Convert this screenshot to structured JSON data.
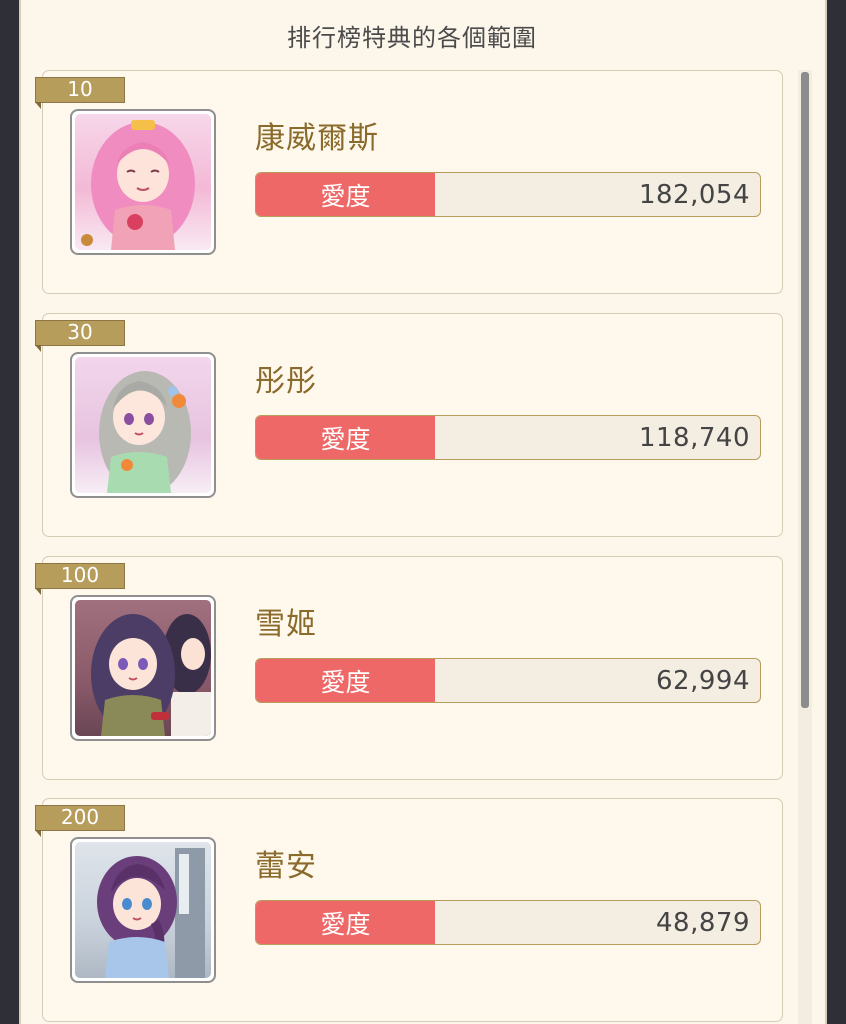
{
  "header": {
    "title": "排行榜特典的各個範圍"
  },
  "ranking": [
    {
      "rank": "10",
      "name": "康威爾斯",
      "stat_label": "愛度",
      "stat_value": "182,054"
    },
    {
      "rank": "30",
      "name": "彤彤",
      "stat_label": "愛度",
      "stat_value": "118,740"
    },
    {
      "rank": "100",
      "name": "雪姬",
      "stat_label": "愛度",
      "stat_value": "62,994"
    },
    {
      "rank": "200",
      "name": "蕾安",
      "stat_label": "愛度",
      "stat_value": "48,879"
    }
  ],
  "colors": {
    "panel_bg": "#fdf6ea",
    "rank_tab": "#b69d5b",
    "stat_label_bg": "#ee6868",
    "name_text": "#8b6b2b"
  }
}
